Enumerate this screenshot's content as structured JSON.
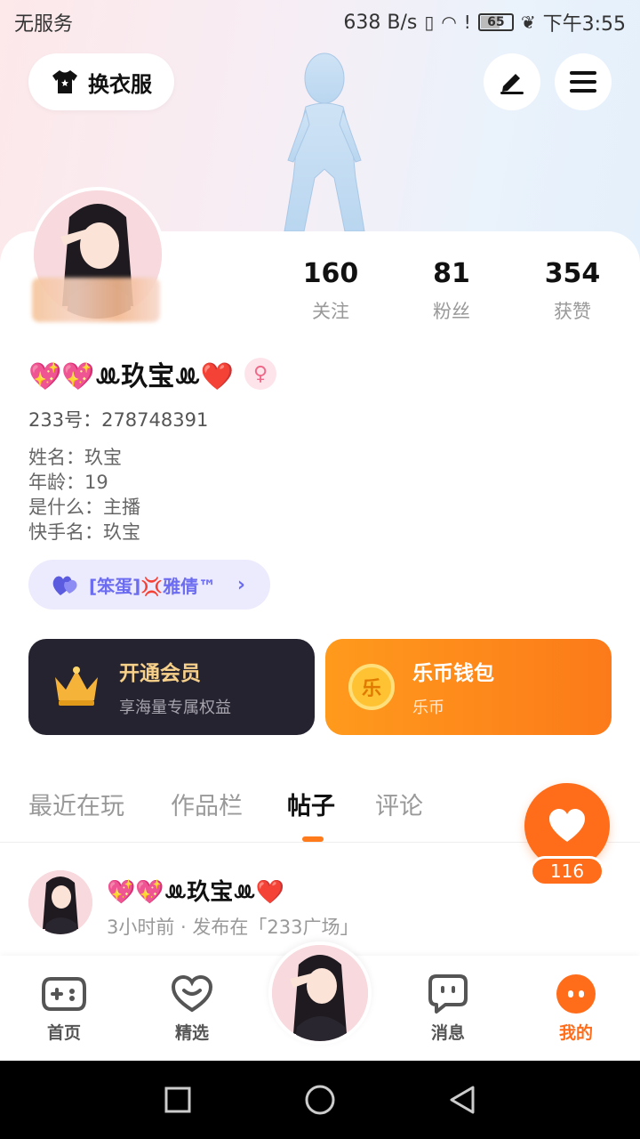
{
  "status_bar": {
    "carrier": "无服务",
    "speed": "638 B/s",
    "battery": "65",
    "time": "下午3:55"
  },
  "top": {
    "outfit_label": "换衣服"
  },
  "profile": {
    "stats": [
      {
        "value": "160",
        "label": "关注"
      },
      {
        "value": "81",
        "label": "粉丝"
      },
      {
        "value": "354",
        "label": "获赞"
      }
    ],
    "username": "💖💖ꔛ玖宝ꔛ❤️",
    "gender_symbol": "♀",
    "uid": "233号：278748391",
    "bio": [
      "姓名：玖宝",
      "年龄：19",
      "是什么：主播",
      "快手名：玖宝"
    ],
    "guild": "[笨蛋]💢雅倩™"
  },
  "cards": {
    "vip": {
      "title": "开通会员",
      "subtitle": "享海量专属权益"
    },
    "wallet": {
      "title": "乐币钱包",
      "subtitle": "乐币",
      "coin_glyph": "乐"
    }
  },
  "tabs": [
    "最近在玩",
    "作品栏",
    "帖子",
    "评论"
  ],
  "active_tab": "帖子",
  "like": {
    "count": "116"
  },
  "post": {
    "author": "💖💖ꔛ玖宝ꔛ❤️",
    "meta": "3小时前 · 发布在「233广场」"
  },
  "bottom_nav": {
    "home": "首页",
    "featured": "精选",
    "messages": "消息",
    "me": "我的"
  },
  "colors": {
    "accent": "#ff6c1a",
    "vip_bg": "#25232f",
    "guild_bg": "#eceafd"
  }
}
